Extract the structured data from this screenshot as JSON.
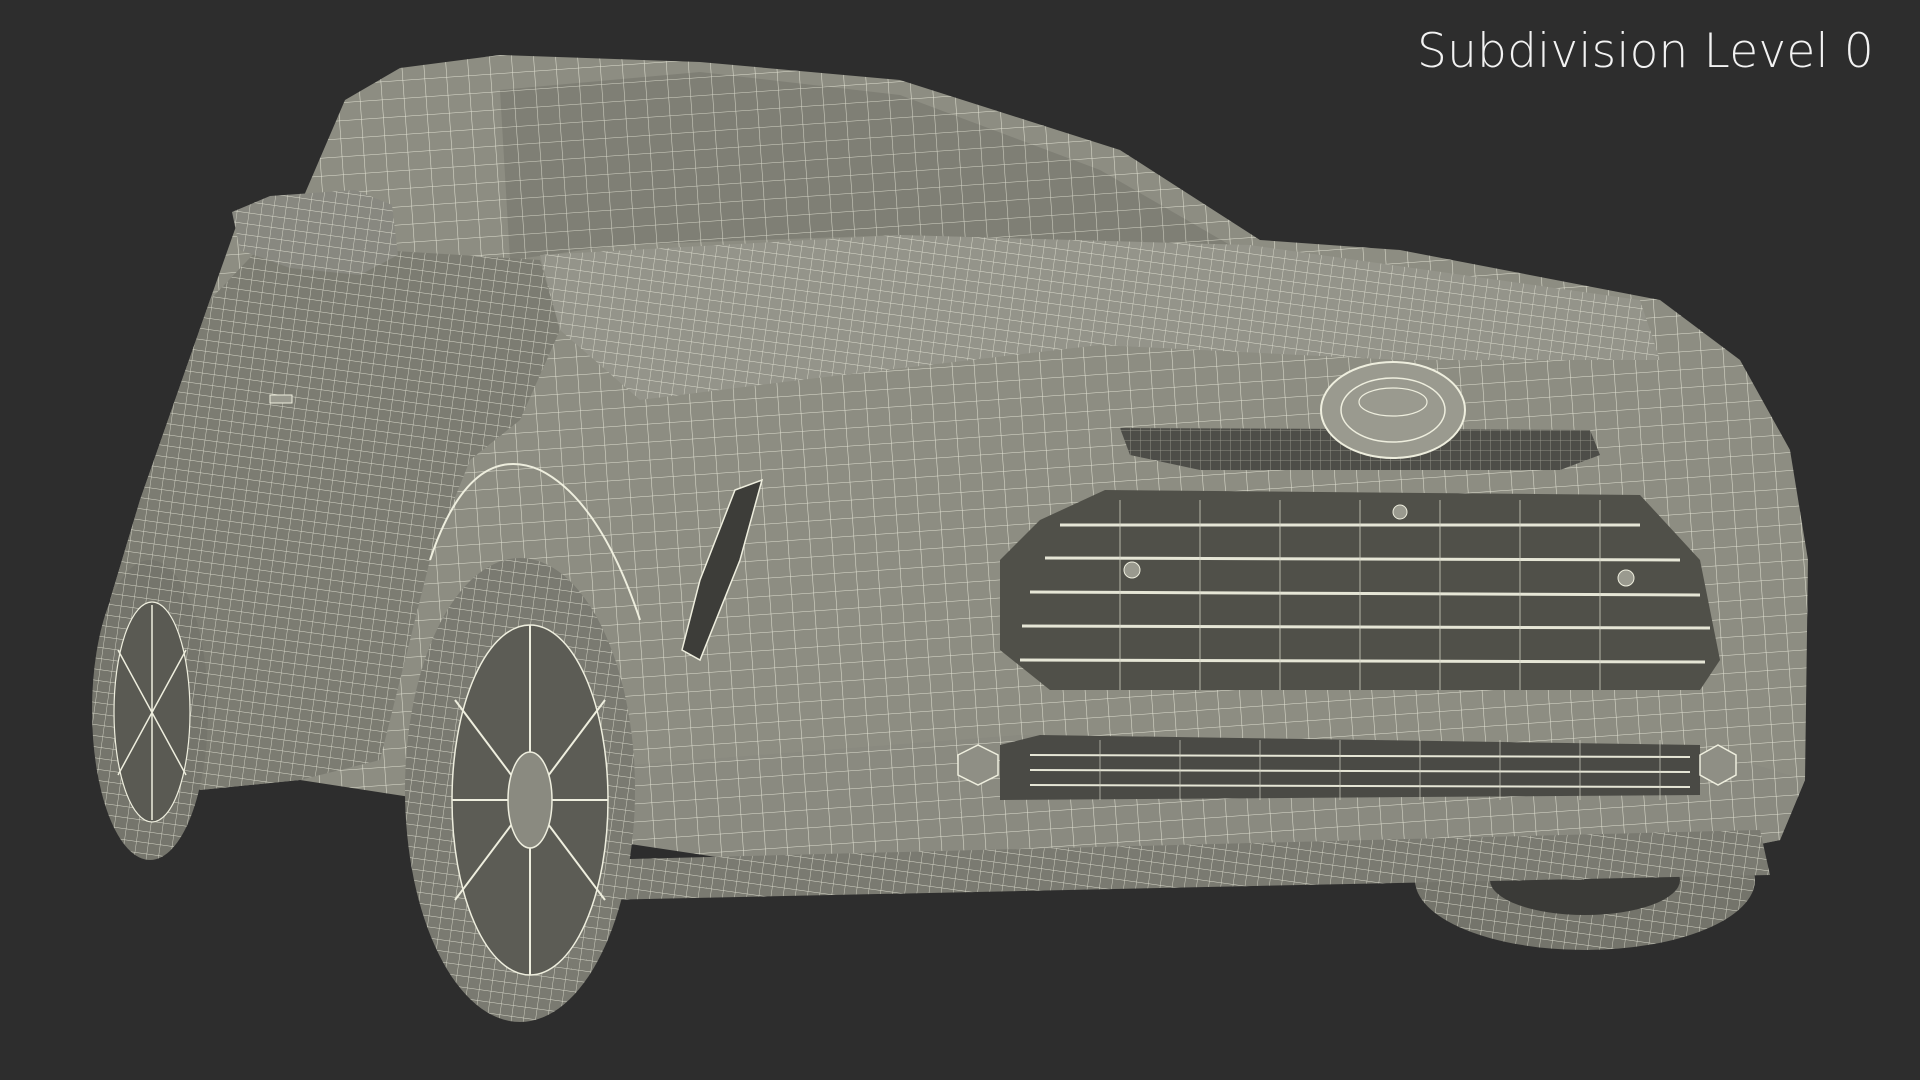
{
  "viewport": {
    "overlay_label": "Subdivision Level 0",
    "background_color": "#2d2d2d",
    "mesh_fill_color": "#8f8f84",
    "mesh_shadow_color": "#6f6f66",
    "wire_color": "#eeeede"
  }
}
